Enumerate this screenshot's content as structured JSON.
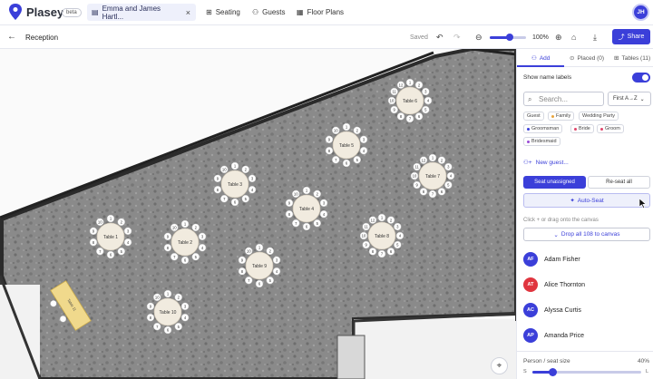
{
  "app": {
    "name": "Plasey",
    "badge": "beta",
    "user_initials": "JH"
  },
  "project_tab": {
    "title": "Emma and James Hartl...",
    "close": "×"
  },
  "nav": [
    {
      "label": "Seating",
      "icon": "grid-icon"
    },
    {
      "label": "Guests",
      "icon": "users-icon"
    },
    {
      "label": "Floor Plans",
      "icon": "floorplan-icon"
    }
  ],
  "toolbar": {
    "room": "Reception",
    "saved": "Saved",
    "zoom": "100%",
    "zoom_fraction": 0.55,
    "share": "Share"
  },
  "panel": {
    "tabs": [
      {
        "label": "Add",
        "active": true
      },
      {
        "label": "Placed (0)",
        "active": false
      },
      {
        "label": "Tables (11)",
        "active": false
      }
    ],
    "show_name_labels": "Show name labels",
    "show_name_labels_on": true,
    "search_placeholder": "Search...",
    "sort": "First A→Z",
    "chips": [
      {
        "label": "Guest",
        "color": ""
      },
      {
        "label": "Family",
        "color": "#e8a33a"
      },
      {
        "label": "Wedding Party",
        "color": ""
      },
      {
        "label": "Groomsman",
        "color": "#3b3fd9"
      },
      {
        "label": "Bride",
        "color": "#e0456b"
      },
      {
        "label": "Groom",
        "color": "#e0456b"
      },
      {
        "label": "Bridesmaid",
        "color": "#9a4bd6"
      }
    ],
    "new_guest": "New guest...",
    "seat_unassigned": "Seat unassigned",
    "reseat_all": "Re-seat all",
    "auto_seat": "Auto-Seat",
    "hint": "Click + or drag onto the canvas",
    "drop_all": "Drop all 108 to canvas",
    "guests": [
      {
        "initials": "AF",
        "name": "Adam Fisher",
        "color": "#3b3fd9"
      },
      {
        "initials": "AT",
        "name": "Alice Thornton",
        "color": "#e0353f"
      },
      {
        "initials": "AC",
        "name": "Alyssa Curtis",
        "color": "#3b3fd9"
      },
      {
        "initials": "AP",
        "name": "Amanda Price",
        "color": "#3b3fd9"
      }
    ],
    "seat_size_label": "Person / seat size",
    "seat_size": "40%",
    "seat_size_fraction": 0.18,
    "seat_size_min": "S",
    "seat_size_max": "L"
  },
  "tables": [
    {
      "name": "Table 1",
      "seats": 10
    },
    {
      "name": "Table 2",
      "seats": 10
    },
    {
      "name": "Table 3",
      "seats": 10
    },
    {
      "name": "Table 4",
      "seats": 10
    },
    {
      "name": "Table 5",
      "seats": 10
    },
    {
      "name": "Table 6",
      "seats": 12
    },
    {
      "name": "Table 7",
      "seats": 12
    },
    {
      "name": "Table 8",
      "seats": 12
    },
    {
      "name": "Table 9",
      "seats": 10
    },
    {
      "name": "Table 10",
      "seats": 10
    },
    {
      "name": "Table 11",
      "seats": 4
    }
  ]
}
